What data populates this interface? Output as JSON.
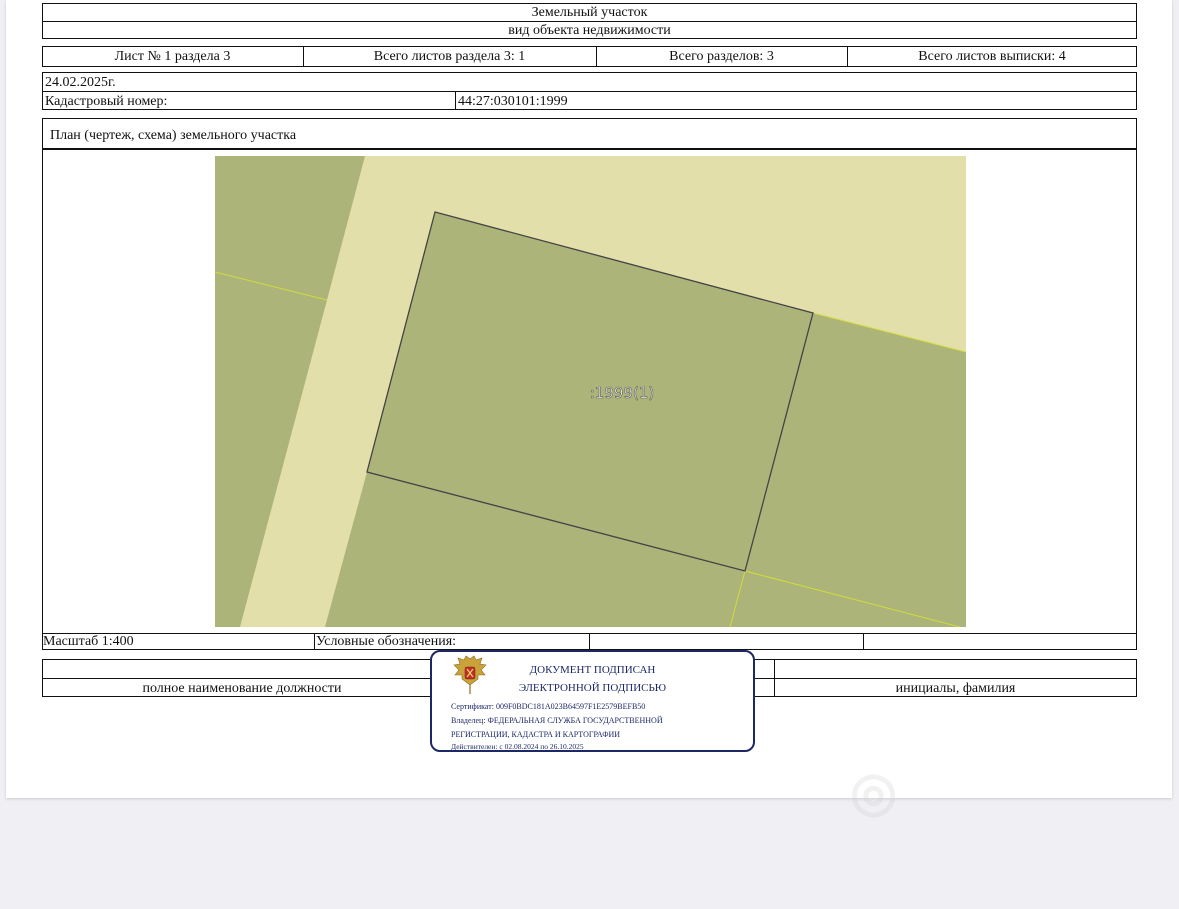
{
  "header": {
    "title": "Земельный участок",
    "subtitle": "вид объекта недвижимости"
  },
  "sheet_info": {
    "sheet": "Лист № 1 раздела 3",
    "sheets_in_section": "Всего листов раздела 3: 1",
    "sections_total": "Всего разделов: 3",
    "sheets_total": "Всего листов выписки: 4"
  },
  "record": {
    "date": "24.02.2025г.",
    "cadastral_label": "Кадастровый номер:",
    "cadastral_number": "44:27:030101:1999"
  },
  "plan": {
    "title": "План (чертеж, схема) земельного участка",
    "parcel_label": ":1999(1)",
    "colors": {
      "parcel": "#acb47a",
      "road": "#e3dfaa",
      "border": "#444444",
      "neighbor_line": "#d2dc3c"
    }
  },
  "footer": {
    "scale": "Масштаб 1:400",
    "legend_label": "Условные обозначения:",
    "position_caption": "полное наименование должности",
    "initials_caption": "инициалы, фамилия"
  },
  "signature": {
    "line1": "ДОКУМЕНТ ПОДПИСАН",
    "line2": "ЭЛЕКТРОННОЙ ПОДПИСЬЮ",
    "certificate": "Сертификат: 009F0BDC181A023B64597F1E2579BEFB50",
    "owner_line1": "Владелец: ФЕДЕРАЛЬНАЯ СЛУЖБА ГОСУДАРСТВЕННОЙ",
    "owner_line2": "РЕГИСТРАЦИИ, КАДАСТРА И КАРТОГРАФИИ",
    "valid": "Действителен: с 02.08.2024 по 26.10.2025",
    "emblem_icon": "coat-of-arms-icon",
    "color": "#1c2866"
  }
}
